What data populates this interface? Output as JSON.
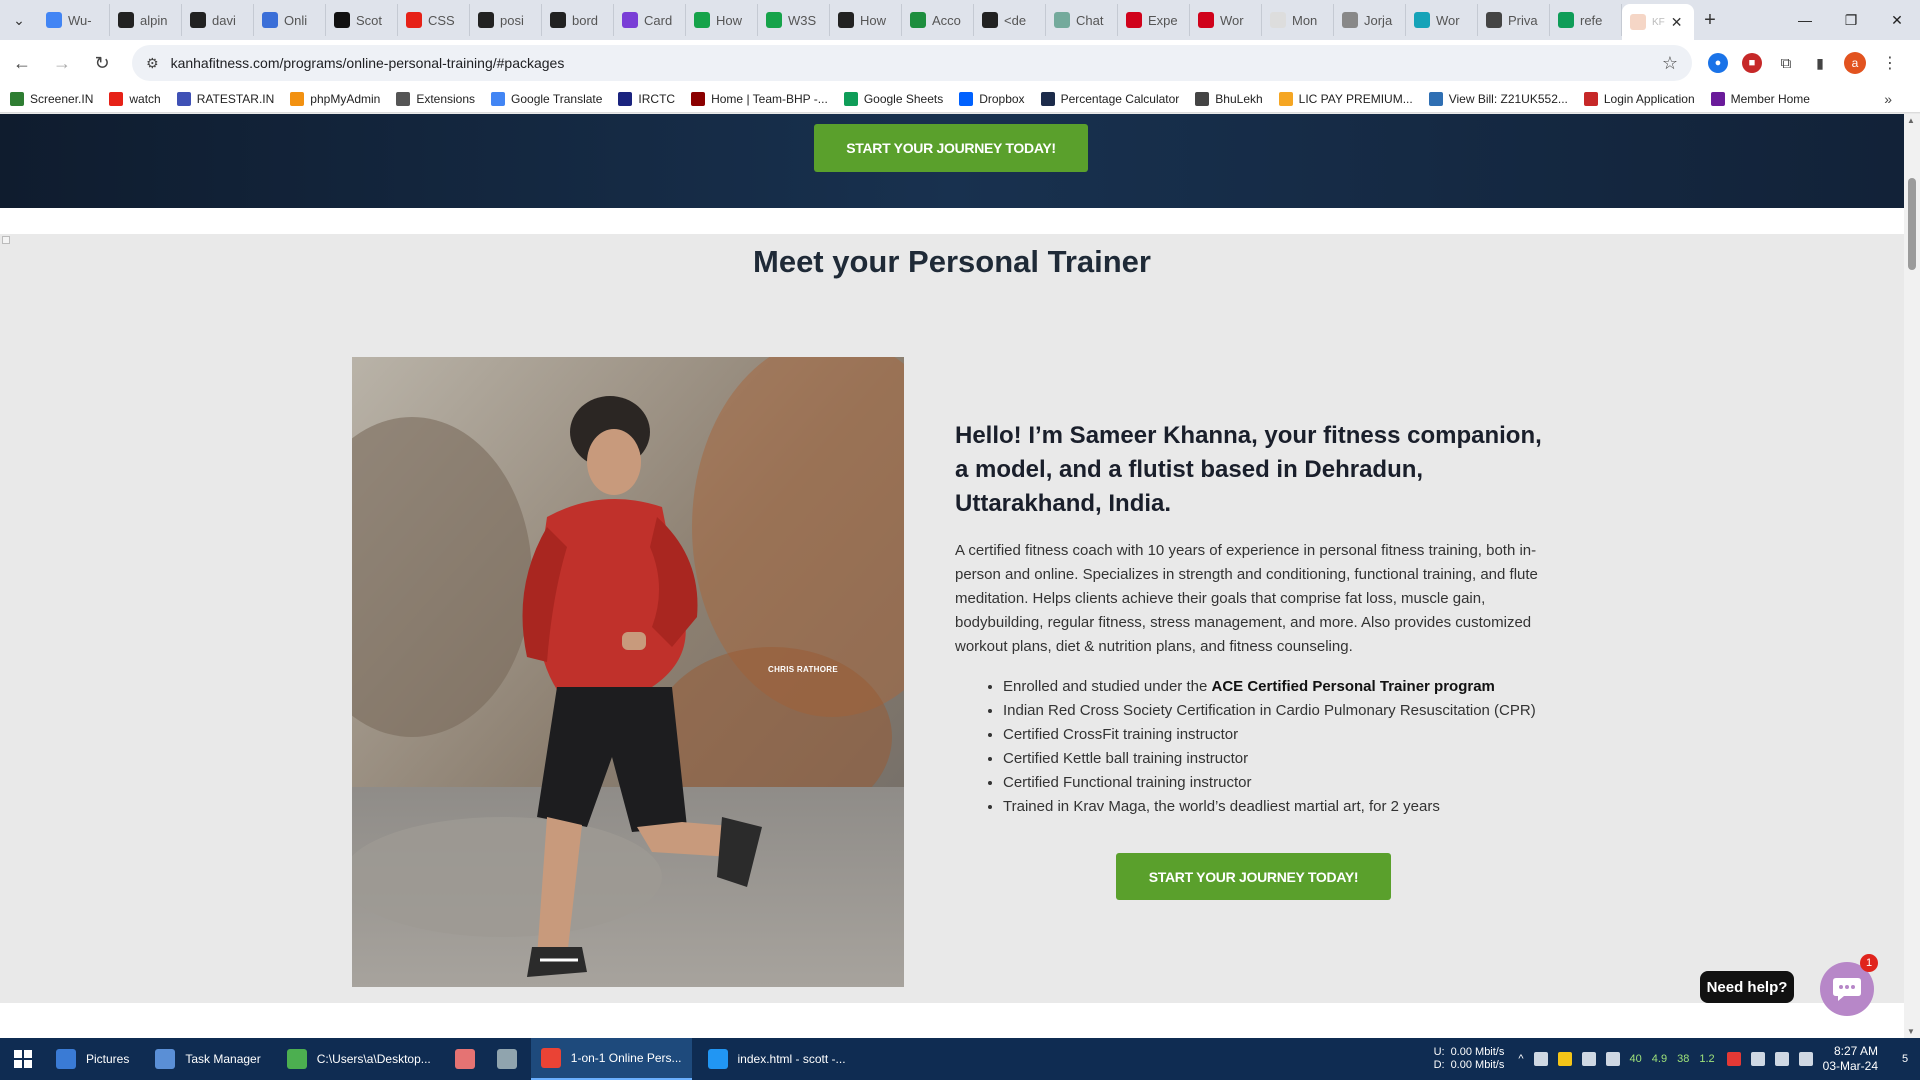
{
  "browser": {
    "tabs": [
      {
        "label": "Wu-",
        "color": "#4285f4"
      },
      {
        "label": "alpin",
        "color": "#222222"
      },
      {
        "label": "davi",
        "color": "#222222"
      },
      {
        "label": "Onli",
        "color": "#3b6fd8"
      },
      {
        "label": "Scot",
        "color": "#111111"
      },
      {
        "label": "CSS",
        "color": "#e62117"
      },
      {
        "label": "posi",
        "color": "#222222"
      },
      {
        "label": "bord",
        "color": "#222222"
      },
      {
        "label": "Card",
        "color": "#7a3ed6"
      },
      {
        "label": "How",
        "color": "#16a34a"
      },
      {
        "label": "W3S",
        "color": "#16a34a"
      },
      {
        "label": "How",
        "color": "#222222"
      },
      {
        "label": "Acco",
        "color": "#1e8e3e"
      },
      {
        "label": "<de",
        "color": "#222222"
      },
      {
        "label": "Chat",
        "color": "#74aa9c"
      },
      {
        "label": "Expe",
        "color": "#d0021b"
      },
      {
        "label": "Wor",
        "color": "#d0021b"
      },
      {
        "label": "Mon",
        "color": "#dddddd"
      },
      {
        "label": "Jorja",
        "color": "#888888"
      },
      {
        "label": "Wor",
        "color": "#16a3b8"
      },
      {
        "label": "Priva",
        "color": "#444444"
      },
      {
        "label": "refe",
        "color": "#0f9d58"
      }
    ],
    "active_tab": {
      "label": "KF",
      "close": "✕"
    },
    "new_tab": "+",
    "window": {
      "minimize": "—",
      "maximize": "❐",
      "close": "✕"
    },
    "url": "kanhafitness.com/programs/online-personal-training/#packages",
    "profile_initial": "a",
    "bookmarks": [
      {
        "label": "Screener.IN",
        "color": "#2e7d32"
      },
      {
        "label": "watch",
        "color": "#e62117"
      },
      {
        "label": "RATESTAR.IN",
        "color": "#3f51b5"
      },
      {
        "label": "phpMyAdmin",
        "color": "#f29111"
      },
      {
        "label": "Extensions",
        "color": "#555555"
      },
      {
        "label": "Google Translate",
        "color": "#4285f4"
      },
      {
        "label": "IRCTC",
        "color": "#1a237e"
      },
      {
        "label": "Home | Team-BHP -...",
        "color": "#8b0000"
      },
      {
        "label": "Google Sheets",
        "color": "#0f9d58"
      },
      {
        "label": "Dropbox",
        "color": "#0061fe"
      },
      {
        "label": "Percentage Calculator",
        "color": "#1c2b4a"
      },
      {
        "label": "BhuLekh",
        "color": "#444444"
      },
      {
        "label": "LIC PAY PREMIUM...",
        "color": "#f5a623"
      },
      {
        "label": "View Bill: Z21UK552...",
        "color": "#2f6fb3"
      },
      {
        "label": "Login Application",
        "color": "#c62828"
      },
      {
        "label": "Member Home",
        "color": "#6a1b9a"
      }
    ],
    "bookmarks_more": "»"
  },
  "page": {
    "cta_top": "START YOUR JOURNEY TODAY!",
    "section_title": "Meet your Personal Trainer",
    "photo_caption": "CHRIS RATHORE",
    "bio_heading": "Hello! I’m Sameer Khanna, your fitness companion, a model, and a flutist based in Dehradun, Uttarakhand, India.",
    "bio_paragraph": "A certified fitness coach with 10 years of experience in personal fitness training, both in-person and online. Specializes in strength and conditioning, functional training, and flute meditation. Helps clients achieve their goals that comprise fat loss, muscle gain, bodybuilding, regular fitness, stress management, and more. Also provides customized workout plans, diet & nutrition plans, and fitness counseling.",
    "credential_1_prefix": "Enrolled and studied under the ",
    "credential_1_bold": "ACE Certified Personal Trainer program",
    "credentials": [
      "Indian Red Cross Society Certification in Cardio Pulmonary Resuscitation (CPR)",
      "Certified CrossFit training instructor",
      "Certified Kettle ball training instructor",
      "Certified Functional training instructor",
      "Trained in Krav Maga, the world’s deadliest martial art, for 2 years"
    ],
    "cta_bottom": "START YOUR JOURNEY TODAY!",
    "help_text": "Need help?",
    "chat_badge": "1"
  },
  "taskbar": {
    "items": [
      {
        "label": "Pictures",
        "color": "#3a7bd5"
      },
      {
        "label": "Task Manager",
        "color": "#5a8fd6"
      },
      {
        "label": "C:\\Users\\a\\Desktop...",
        "color": "#4caf50"
      },
      {
        "label": "",
        "color": "#e57373"
      },
      {
        "label": "",
        "color": "#90a4ae"
      },
      {
        "label": "1-on-1 Online Pers...",
        "color": "#ea4335"
      },
      {
        "label": "index.html - scott -...",
        "color": "#2196f3"
      }
    ],
    "net_up_label": "U:",
    "net_down_label": "D:",
    "net_up": "0.00 Mbit/s",
    "net_down": "0.00 Mbit/s",
    "tray_nums": [
      "40",
      "4.9",
      "38",
      "1.2"
    ],
    "time": "8:27 AM",
    "date": "03-Mar-24",
    "notifications": "5"
  }
}
